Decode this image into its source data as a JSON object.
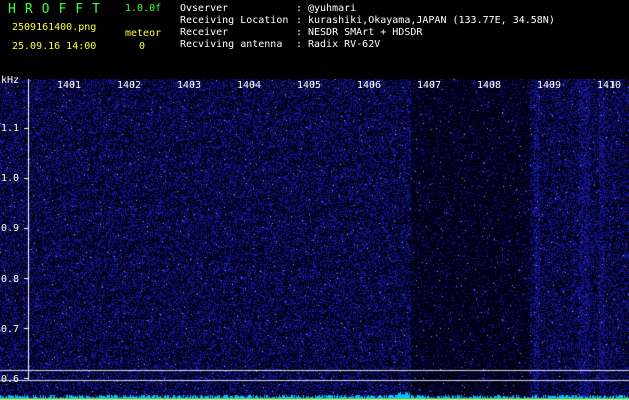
{
  "header": {
    "app_title": "HROFFT",
    "version": "1.0.0f",
    "file_name": "2509161400.png",
    "date_time": "25.09.16 14:00",
    "mode_label": "meteor",
    "count": "0"
  },
  "station_info": [
    {
      "label": "Ovserver",
      "value": "@yuhmari"
    },
    {
      "label": "Receiving Location",
      "value": "kurashiki,Okayama,JAPAN (133.77E, 34.58N)"
    },
    {
      "label": "Receiver",
      "value": "NESDR SMArt + HDSDR"
    },
    {
      "label": "Recviving antenna",
      "value": "Radix RV-62V"
    }
  ],
  "axis": {
    "y_unit": "kHz",
    "y_ticks": [
      "1.1",
      "1.0",
      "0.9",
      "0.8",
      "0.7",
      "0.6"
    ],
    "x_ticks": [
      "1401",
      "1402",
      "1403",
      "1404",
      "1405",
      "1406",
      "1407",
      "1408",
      "1409",
      "1410"
    ]
  },
  "colors": {
    "text_green": "#3cff3c",
    "text_yellow": "#ffff3c",
    "background": "#000000",
    "noise_blue": "#1a1aa0",
    "signal_cyan": "#00c8ff"
  }
}
